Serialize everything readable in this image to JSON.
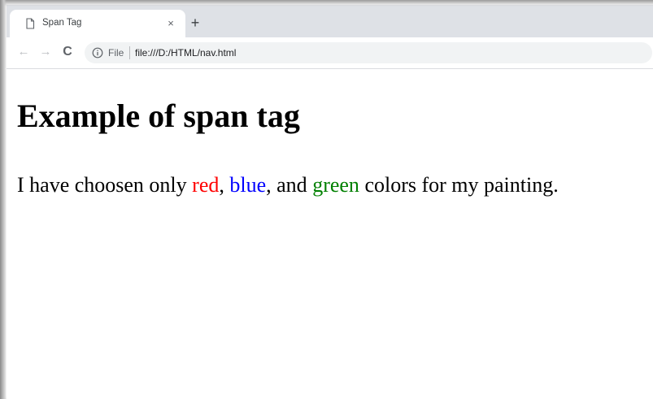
{
  "browser": {
    "tab": {
      "title": "Span Tag",
      "page_icon": "document-icon",
      "close_label": "×"
    },
    "new_tab_label": "+",
    "toolbar": {
      "back_icon": "arrow-left-icon",
      "forward_icon": "arrow-right-icon",
      "reload_icon": "reload-icon",
      "back_glyph": "←",
      "forward_glyph": "→",
      "reload_glyph": "C",
      "address": {
        "info_icon": "info-icon",
        "scheme_label": "File",
        "url": "file:///D:/HTML/nav.html"
      }
    }
  },
  "page": {
    "heading": "Example of span tag",
    "paragraph": {
      "prefix": "I have choosen only ",
      "red_word": "red",
      "sep1": ", ",
      "blue_word": "blue",
      "sep2": ", and ",
      "green_word": "green",
      "suffix": " colors for my painting."
    }
  },
  "colors": {
    "red": "#ff0000",
    "blue": "#0000ff",
    "green": "#008000",
    "tab_strip": "#dee1e6",
    "omnibox": "#f1f3f4"
  }
}
